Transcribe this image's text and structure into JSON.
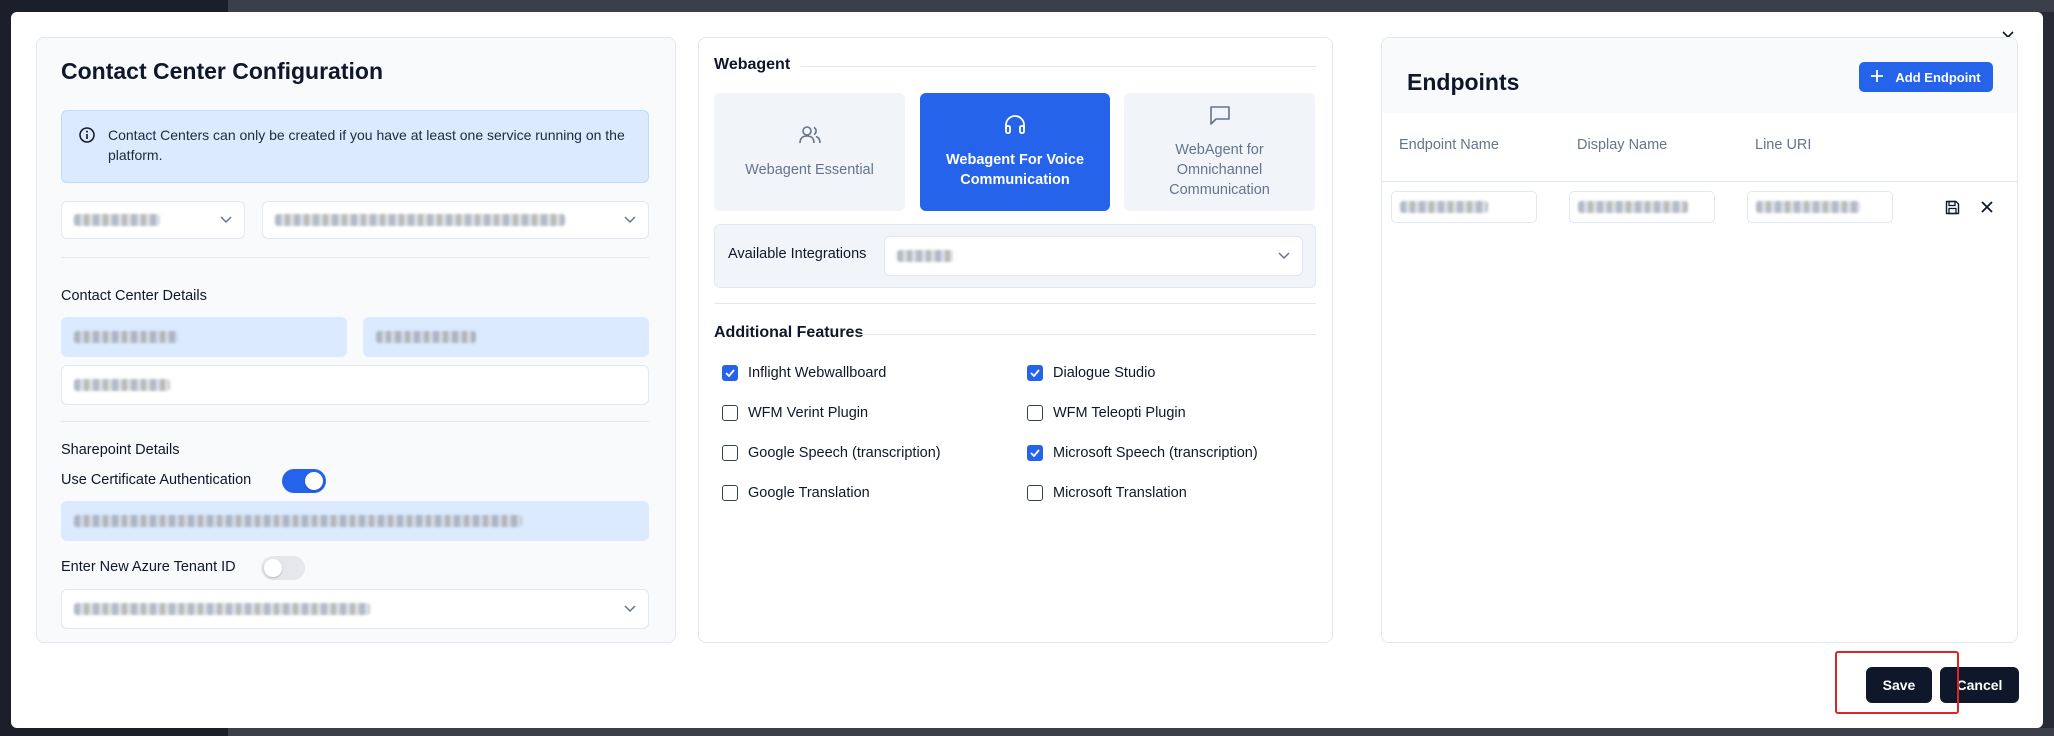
{
  "left_panel": {
    "title": "Contact Center Configuration",
    "info_text": "Contact Centers can only be created if you have at least one service running on the platform.",
    "details_label": "Contact Center Details",
    "sharepoint_label": "Sharepoint Details",
    "cert_auth_label": "Use Certificate Authentication",
    "cert_auth_on": true,
    "azure_tenant_label": "Enter New Azure Tenant ID",
    "azure_tenant_on": false
  },
  "webagent": {
    "section_title": "Webagent",
    "cards": [
      {
        "label": "Webagent Essential",
        "icon": "users-icon",
        "active": false
      },
      {
        "label": "Webagent For Voice Communication",
        "icon": "headphones-icon",
        "active": true
      },
      {
        "label": "WebAgent for Omnichannel Communication",
        "icon": "chat-icon",
        "active": false
      }
    ],
    "integrations_label": "Available Integrations",
    "features_title": "Additional Features",
    "features": [
      {
        "label": "Inflight Webwallboard",
        "checked": true
      },
      {
        "label": "Dialogue Studio",
        "checked": true
      },
      {
        "label": "WFM Verint Plugin",
        "checked": false
      },
      {
        "label": "WFM Teleopti Plugin",
        "checked": false
      },
      {
        "label": "Google Speech (transcription)",
        "checked": false
      },
      {
        "label": "Microsoft Speech (transcription)",
        "checked": true
      },
      {
        "label": "Google Translation",
        "checked": false
      },
      {
        "label": "Microsoft Translation",
        "checked": false
      }
    ]
  },
  "endpoints": {
    "title": "Endpoints",
    "add_label": "Add Endpoint",
    "columns": [
      "Endpoint Name",
      "Display Name",
      "Line URI"
    ]
  },
  "footer": {
    "save_label": "Save",
    "cancel_label": "Cancel"
  },
  "colors": {
    "accent": "#2563eb",
    "dark_button": "#0f172a",
    "highlight": "#dc2626"
  }
}
